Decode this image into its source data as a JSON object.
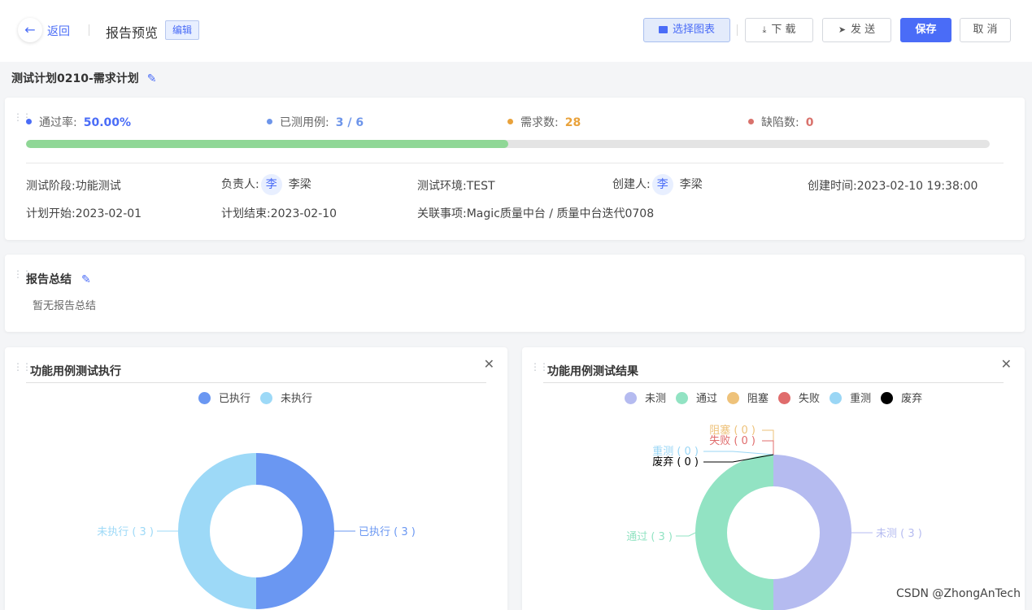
{
  "header": {
    "back_label": "返回",
    "page_title": "报告预览",
    "edit_tag": "编辑",
    "toolbar": {
      "choose_chart": "选择图表",
      "download": "下 载",
      "send": "发 送",
      "save": "保存",
      "cancel": "取 消"
    }
  },
  "plan": {
    "title": "测试计划0210-需求计划"
  },
  "stats": {
    "pass_rate": {
      "label": "通过率:",
      "value": "50.00%",
      "color": "#4a6cf7"
    },
    "tested_cases": {
      "label": "已测用例:",
      "value": "3 / 6",
      "color": "#6d95ea"
    },
    "requirements": {
      "label": "需求数:",
      "value": "28",
      "color": "#e9a23b"
    },
    "defects": {
      "label": "缺陷数:",
      "value": "0",
      "color": "#d9726c"
    },
    "progress": 0.5
  },
  "meta": {
    "stage_label": "测试阶段:",
    "stage": "功能测试",
    "owner_label": "负责人:",
    "owner_avatar": "李",
    "owner": "李梁",
    "env_label": "测试环境:",
    "env": "TEST",
    "creator_label": "创建人:",
    "creator_avatar": "李",
    "creator": "李梁",
    "created_label": "创建时间:",
    "created": "2023-02-10 19:38:00",
    "start_label": "计划开始:",
    "start": "2023-02-01",
    "end_label": "计划结束:",
    "end": "2023-02-10",
    "related_label": "关联事项:",
    "related": "Magic质量中台 / 质量中台迭代0708"
  },
  "summary": {
    "title": "报告总结",
    "empty_text": "暂无报告总结"
  },
  "chart_data": [
    {
      "type": "pie",
      "title": "功能用例测试执行",
      "series": [
        {
          "name": "已执行",
          "value": 3,
          "color": "#6a97f2"
        },
        {
          "name": "未执行",
          "value": 3,
          "color": "#9dd9f7"
        }
      ],
      "labels": [
        "已执行 ( 3 )",
        "未执行 ( 3 )"
      ]
    },
    {
      "type": "pie",
      "title": "功能用例测试结果",
      "series": [
        {
          "name": "未测",
          "value": 3,
          "color": "#b5bbf0"
        },
        {
          "name": "通过",
          "value": 3,
          "color": "#92e3c3"
        },
        {
          "name": "阻塞",
          "value": 0,
          "color": "#eec27a"
        },
        {
          "name": "失败",
          "value": 0,
          "color": "#e06c6c"
        },
        {
          "name": "重测",
          "value": 0,
          "color": "#9ad6f5"
        },
        {
          "name": "废弃",
          "value": 0,
          "color": "#000000"
        }
      ],
      "labels": [
        "未测 ( 3 )",
        "通过 ( 3 )",
        "阻塞 ( 0 )",
        "失败 ( 0 )",
        "重测 ( 0 )",
        "废弃 ( 0 )"
      ]
    }
  ],
  "watermark": "CSDN @ZhongAnTech"
}
